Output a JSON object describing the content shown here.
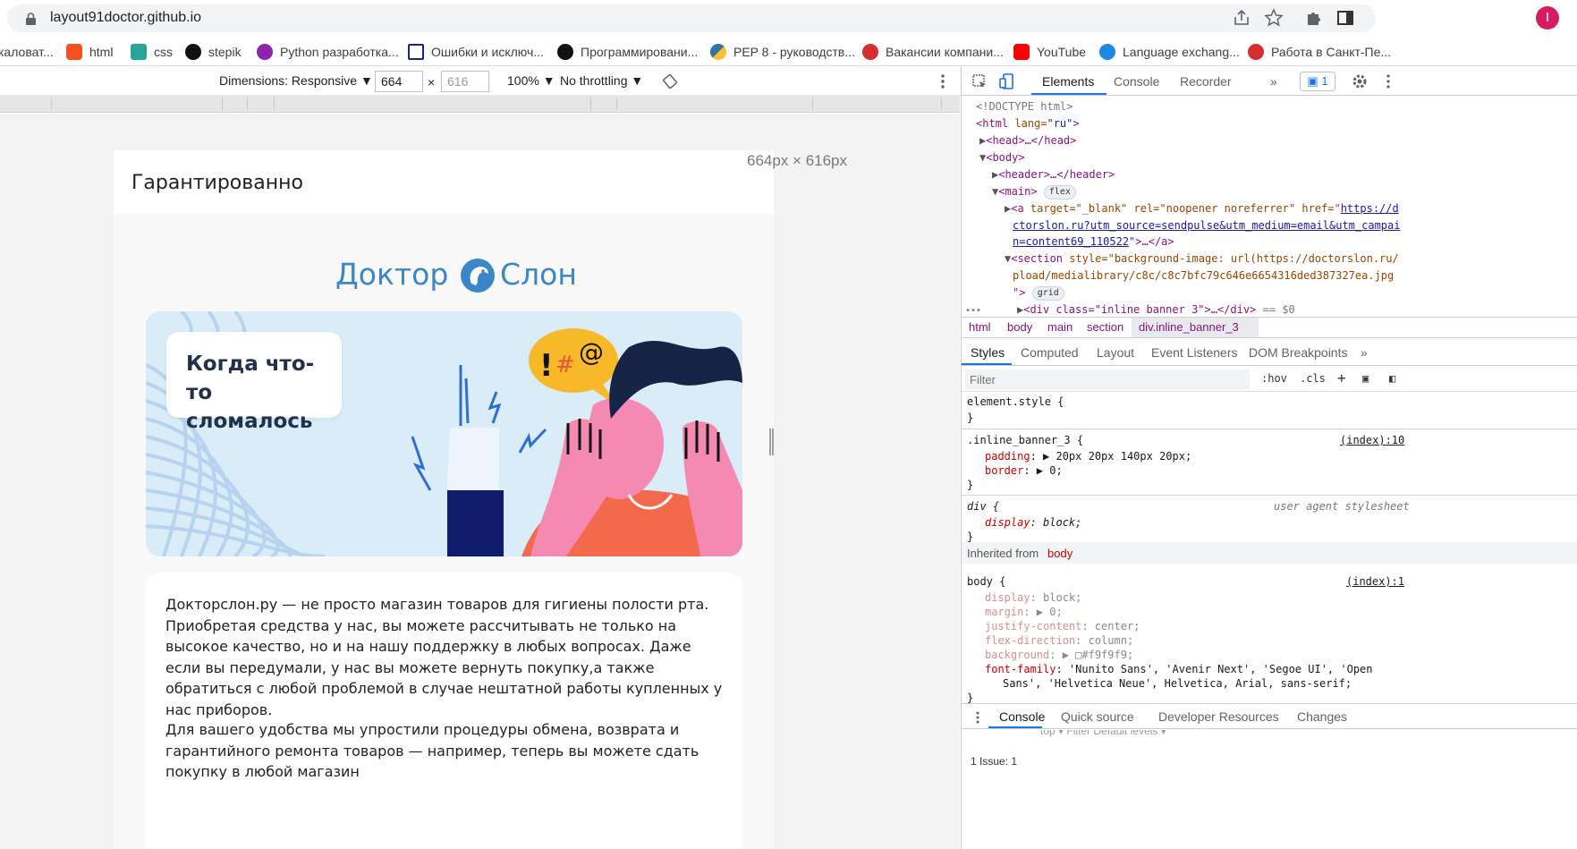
{
  "browser": {
    "url": "layout91doctor.github.io",
    "avatar_letter": "I",
    "bookmarks": [
      {
        "label": "каловат...",
        "color": "#5f6368"
      },
      {
        "label": "html",
        "color": "#f4511e"
      },
      {
        "label": "css",
        "color": "#26a69a"
      },
      {
        "label": "stepik",
        "color": "#111111"
      },
      {
        "label": "Python разработка...",
        "color": "#8e24aa"
      },
      {
        "label": "Ошибки и исключ...",
        "color": "#1a237e"
      },
      {
        "label": "Программировани...",
        "color": "#111111"
      },
      {
        "label": "PEP 8 - руководств...",
        "color": "#fbc02d"
      },
      {
        "label": "Вакансии компани...",
        "color": "#d32f2f"
      },
      {
        "label": "YouTube",
        "color": "#ff0000"
      },
      {
        "label": "Language exchang...",
        "color": "#1e88e5"
      },
      {
        "label": "Работа в Санкт-Пе...",
        "color": "#d32f2f"
      }
    ]
  },
  "device_toolbar": {
    "dimensions_label": "Dimensions: Responsive ▼",
    "width": "664",
    "height": "616",
    "times": "×",
    "zoom": "100% ▼",
    "throttling": "No throttling ▼"
  },
  "page": {
    "title": "Гарантированно",
    "dims": "664px × 616px",
    "logo_left": "Доктор",
    "logo_right": "Слон",
    "banner_title": "Когда что-то сломалось",
    "paragraph_1": "Докторслон.ру — не просто магазин товаров для гигиены полости рта. Приобретая средства у нас, вы можете рассчитывать не только на высокое качество, но и на нашу поддержку в любых вопросах. Даже если вы передумали, у нас вы можете вернуть покупку,а также обратиться с любой проблемой в случае нештатной работы купленных у нас приборов.",
    "paragraph_2": "Для вашего удобства мы упростили процедуры обмена, возврата и гарантийного ремонта товаров — например, теперь вы можете сдать покупку в любой магазин"
  },
  "devtools": {
    "tabs": [
      "Elements",
      "Console",
      "Recorder",
      "»"
    ],
    "issues_count": "1",
    "dom": {
      "doctype": "<!DOCTYPE html>",
      "html_tag": "<html",
      "html_attr": " lang=",
      "html_val": "\"ru\"",
      "html_close": ">",
      "head": "<head>…</head>",
      "body": "<body>",
      "header": "<header>…</header>",
      "main": "<main>",
      "flex_pill": "flex",
      "a_open": "<a",
      "a_attrs": " target=\"_blank\" rel=\"noopener noreferrer\" href=\"",
      "a_link1": "https://d",
      "a_link2": "ctorslon.ru?utm_source=sendpulse&utm_medium=email&utm_campai",
      "a_link3": "n=content69_110522",
      "a_close": "\">…</a>",
      "section_open": "<section",
      "section_attr": " style=\"background-image: url(https://doctorslon.ru/",
      "section_attr2": "pload/medialibrary/c8c/c8c7bfc79c646e6654316ded387327ea.jpg",
      "section_close": "\">",
      "grid_pill": "grid",
      "div_line": "<div class=\"inline banner 3\">…</div>",
      "div_eq": " == $0",
      "dots": "•••"
    },
    "breadcrumbs": [
      "html",
      "body",
      "main",
      "section",
      "div.inline_banner_3"
    ],
    "styles_tabs": [
      "Styles",
      "Computed",
      "Layout",
      "Event Listeners",
      "DOM Breakpoints",
      "»"
    ],
    "filter_placeholder": "Filter",
    "hov": ":hov",
    "cls": ".cls",
    "rules": {
      "element_style": "element.style {",
      "close": "}",
      "inline_sel": ".inline_banner_3 {",
      "inline_src": "(index):10",
      "padding_prop": "padding",
      "padding_val": ": ▶ 20px 20px 140px 20px;",
      "border_prop": "border",
      "border_val": ": ▶ 0;",
      "div_sel": "div {",
      "div_src": "user agent stylesheet",
      "display_prop": "display",
      "display_val": ": block;",
      "inherited_label": "Inherited from",
      "inherited_from": "body",
      "body_sel": "body {",
      "body_src": "(index):1",
      "body_display": "display",
      "body_display_val": ": block;",
      "body_margin": "margin",
      "body_margin_val": ": ▶ 0;",
      "body_justify": "justify-content",
      "body_justify_val": ": center;",
      "body_flexdir": "flex-direction",
      "body_flexdir_val": ": column;",
      "body_bg": "background",
      "body_bg_val": ": ▶ □#f9f9f9;",
      "body_font": "font-family",
      "body_font_val": ": 'Nunito Sans', 'Avenir Next', 'Segoe UI', 'Open",
      "body_font_val2": "Sans', 'Helvetica Neue', Helvetica, Arial, sans-serif;"
    },
    "drawer_tabs": [
      "Console",
      "Quick source",
      "Developer Resources",
      "Changes"
    ],
    "drawer_toolbar": "top ▾          Filter                                   Default levels ▾",
    "drawer_issues": "1 Issue:  1"
  }
}
